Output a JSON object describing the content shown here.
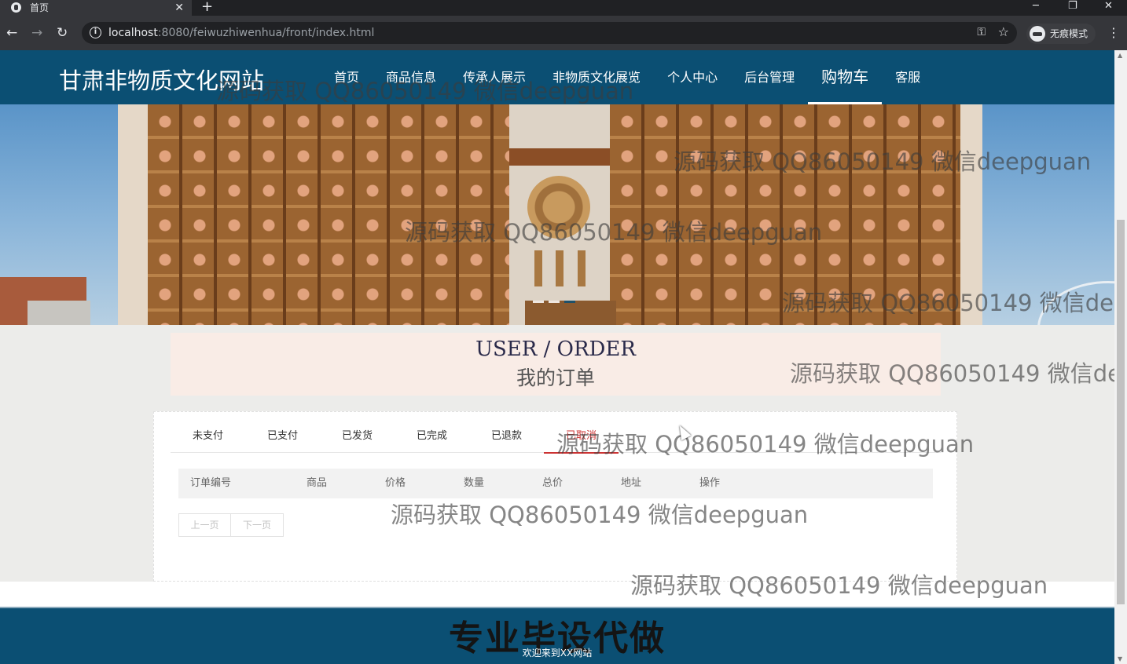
{
  "browser": {
    "tab_title": "首页",
    "tab_close": "✕",
    "new_tab": "+",
    "url_host": "localhost",
    "url_rest": ":8080/feiwuzhiwenhua/front/index.html",
    "incognito_label": "无痕模式",
    "window_controls": {
      "minimize": "─",
      "restore": "❐",
      "close": "✕"
    }
  },
  "site": {
    "logo": "甘肃非物质文化网站",
    "nav": [
      {
        "label": "首页"
      },
      {
        "label": "商品信息"
      },
      {
        "label": "传承人展示"
      },
      {
        "label": "非物质文化展览"
      },
      {
        "label": "个人中心"
      },
      {
        "label": "后台管理"
      },
      {
        "label": "购物车"
      },
      {
        "label": "客服"
      }
    ],
    "active_nav": "购物车"
  },
  "section": {
    "title_en": "USER / ORDER",
    "title_cn": "我的订单"
  },
  "orders": {
    "tabs": [
      "未支付",
      "已支付",
      "已发货",
      "已完成",
      "已退款",
      "已取消"
    ],
    "active_tab": "已取消",
    "columns": [
      "订单编号",
      "商品",
      "价格",
      "数量",
      "总价",
      "地址",
      "操作"
    ],
    "prev_page": "上一页",
    "next_page": "下一页"
  },
  "footer": {
    "big_text": "专业毕设代做",
    "small_text": "欢迎来到XX网站"
  },
  "watermark": "源码获取 QQ86050149 微信deepguan",
  "colors": {
    "header_bg": "#0b4f73",
    "active_tab": "#cc3333",
    "title_bg": "#f9ece6"
  }
}
